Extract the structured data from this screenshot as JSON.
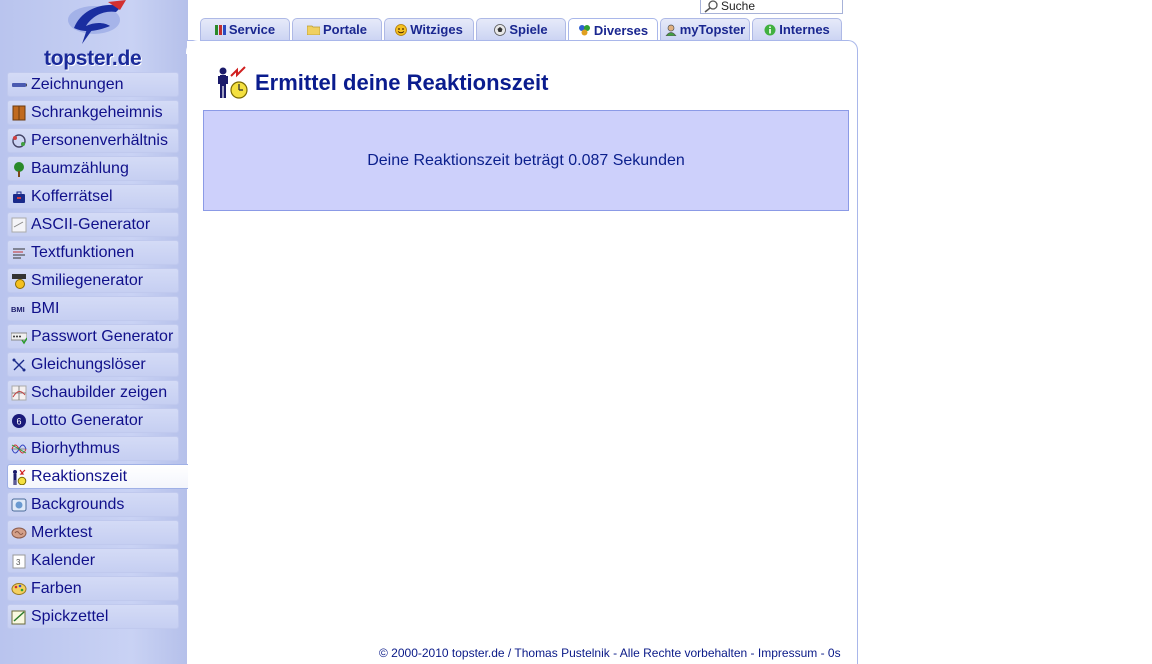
{
  "logo": {
    "text": "topster.de"
  },
  "search": {
    "placeholder": "Suche"
  },
  "tabs": [
    {
      "label": "Service",
      "icon": "books-icon",
      "active": false
    },
    {
      "label": "Portale",
      "icon": "folder-icon",
      "active": false
    },
    {
      "label": "Witziges",
      "icon": "smiley-icon",
      "active": false
    },
    {
      "label": "Spiele",
      "icon": "ball-icon",
      "active": false
    },
    {
      "label": "Diverses",
      "icon": "shapes-icon",
      "active": true
    },
    {
      "label": "myTopster",
      "icon": "user-icon",
      "active": false
    },
    {
      "label": "Internes",
      "icon": "info-icon",
      "active": false
    }
  ],
  "sidebar": {
    "items": [
      {
        "label": "Zeichnungen",
        "icon": "pencil-icon"
      },
      {
        "label": "Schrankgeheimnis",
        "icon": "cabinet-icon"
      },
      {
        "label": "Personenverhältnis",
        "icon": "people-cycle-icon"
      },
      {
        "label": "Baumzählung",
        "icon": "tree-icon"
      },
      {
        "label": "Kofferrätsel",
        "icon": "suitcase-icon"
      },
      {
        "label": "ASCII-Generator",
        "icon": "text-art-icon"
      },
      {
        "label": "Textfunktionen",
        "icon": "text-lines-icon"
      },
      {
        "label": "Smiliegenerator",
        "icon": "smiley-sign-icon"
      },
      {
        "label": "BMI",
        "icon": "bmi-icon"
      },
      {
        "label": "Passwort Generator",
        "icon": "password-icon"
      },
      {
        "label": "Gleichungslöser",
        "icon": "equation-icon"
      },
      {
        "label": "Schaubilder zeigen",
        "icon": "graph-icon"
      },
      {
        "label": "Lotto Generator",
        "icon": "lotto-ball-icon"
      },
      {
        "label": "Biorhythmus",
        "icon": "wave-icon"
      },
      {
        "label": "Reaktionszeit",
        "icon": "reaction-icon",
        "active": true
      },
      {
        "label": "Backgrounds",
        "icon": "image-icon"
      },
      {
        "label": "Merktest",
        "icon": "brain-icon"
      },
      {
        "label": "Kalender",
        "icon": "calendar-icon"
      },
      {
        "label": "Farben",
        "icon": "palette-icon"
      },
      {
        "label": "Spickzettel",
        "icon": "note-icon"
      }
    ]
  },
  "main": {
    "title": "Ermittel deine Reaktionszeit",
    "result": "Deine Reaktionszeit beträgt 0.087 Sekunden"
  },
  "footer": {
    "copyright": "© 2000-2010 topster.de / Thomas Pustelnik",
    "rights": "Alle Rechte vorbehalten",
    "impressum": "Impressum",
    "time": "0s"
  },
  "colors": {
    "accent": "#0a1c8e",
    "sidebar_bg": "#c9d2f4",
    "result_bg": "#cdd0fb"
  }
}
